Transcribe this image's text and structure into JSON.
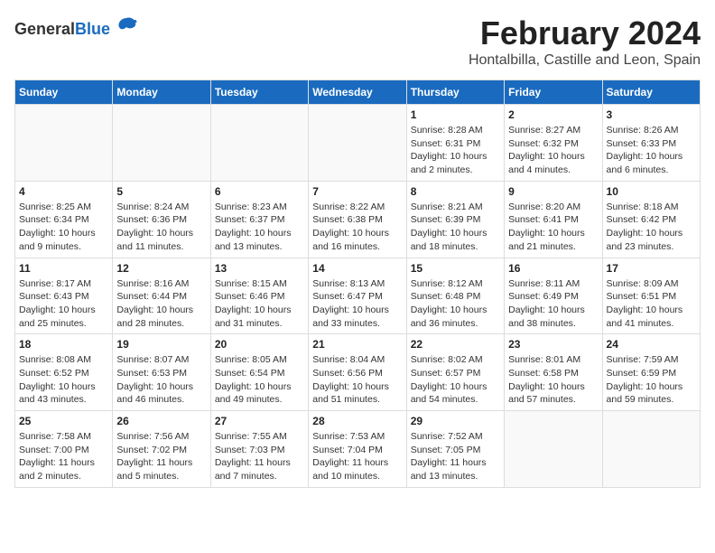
{
  "header": {
    "logo_general": "General",
    "logo_blue": "Blue",
    "month_year": "February 2024",
    "location": "Hontalbilla, Castille and Leon, Spain"
  },
  "weekdays": [
    "Sunday",
    "Monday",
    "Tuesday",
    "Wednesday",
    "Thursday",
    "Friday",
    "Saturday"
  ],
  "weeks": [
    [
      {
        "day": "",
        "info": ""
      },
      {
        "day": "",
        "info": ""
      },
      {
        "day": "",
        "info": ""
      },
      {
        "day": "",
        "info": ""
      },
      {
        "day": "1",
        "info": "Sunrise: 8:28 AM\nSunset: 6:31 PM\nDaylight: 10 hours and 2 minutes."
      },
      {
        "day": "2",
        "info": "Sunrise: 8:27 AM\nSunset: 6:32 PM\nDaylight: 10 hours and 4 minutes."
      },
      {
        "day": "3",
        "info": "Sunrise: 8:26 AM\nSunset: 6:33 PM\nDaylight: 10 hours and 6 minutes."
      }
    ],
    [
      {
        "day": "4",
        "info": "Sunrise: 8:25 AM\nSunset: 6:34 PM\nDaylight: 10 hours and 9 minutes."
      },
      {
        "day": "5",
        "info": "Sunrise: 8:24 AM\nSunset: 6:36 PM\nDaylight: 10 hours and 11 minutes."
      },
      {
        "day": "6",
        "info": "Sunrise: 8:23 AM\nSunset: 6:37 PM\nDaylight: 10 hours and 13 minutes."
      },
      {
        "day": "7",
        "info": "Sunrise: 8:22 AM\nSunset: 6:38 PM\nDaylight: 10 hours and 16 minutes."
      },
      {
        "day": "8",
        "info": "Sunrise: 8:21 AM\nSunset: 6:39 PM\nDaylight: 10 hours and 18 minutes."
      },
      {
        "day": "9",
        "info": "Sunrise: 8:20 AM\nSunset: 6:41 PM\nDaylight: 10 hours and 21 minutes."
      },
      {
        "day": "10",
        "info": "Sunrise: 8:18 AM\nSunset: 6:42 PM\nDaylight: 10 hours and 23 minutes."
      }
    ],
    [
      {
        "day": "11",
        "info": "Sunrise: 8:17 AM\nSunset: 6:43 PM\nDaylight: 10 hours and 25 minutes."
      },
      {
        "day": "12",
        "info": "Sunrise: 8:16 AM\nSunset: 6:44 PM\nDaylight: 10 hours and 28 minutes."
      },
      {
        "day": "13",
        "info": "Sunrise: 8:15 AM\nSunset: 6:46 PM\nDaylight: 10 hours and 31 minutes."
      },
      {
        "day": "14",
        "info": "Sunrise: 8:13 AM\nSunset: 6:47 PM\nDaylight: 10 hours and 33 minutes."
      },
      {
        "day": "15",
        "info": "Sunrise: 8:12 AM\nSunset: 6:48 PM\nDaylight: 10 hours and 36 minutes."
      },
      {
        "day": "16",
        "info": "Sunrise: 8:11 AM\nSunset: 6:49 PM\nDaylight: 10 hours and 38 minutes."
      },
      {
        "day": "17",
        "info": "Sunrise: 8:09 AM\nSunset: 6:51 PM\nDaylight: 10 hours and 41 minutes."
      }
    ],
    [
      {
        "day": "18",
        "info": "Sunrise: 8:08 AM\nSunset: 6:52 PM\nDaylight: 10 hours and 43 minutes."
      },
      {
        "day": "19",
        "info": "Sunrise: 8:07 AM\nSunset: 6:53 PM\nDaylight: 10 hours and 46 minutes."
      },
      {
        "day": "20",
        "info": "Sunrise: 8:05 AM\nSunset: 6:54 PM\nDaylight: 10 hours and 49 minutes."
      },
      {
        "day": "21",
        "info": "Sunrise: 8:04 AM\nSunset: 6:56 PM\nDaylight: 10 hours and 51 minutes."
      },
      {
        "day": "22",
        "info": "Sunrise: 8:02 AM\nSunset: 6:57 PM\nDaylight: 10 hours and 54 minutes."
      },
      {
        "day": "23",
        "info": "Sunrise: 8:01 AM\nSunset: 6:58 PM\nDaylight: 10 hours and 57 minutes."
      },
      {
        "day": "24",
        "info": "Sunrise: 7:59 AM\nSunset: 6:59 PM\nDaylight: 10 hours and 59 minutes."
      }
    ],
    [
      {
        "day": "25",
        "info": "Sunrise: 7:58 AM\nSunset: 7:00 PM\nDaylight: 11 hours and 2 minutes."
      },
      {
        "day": "26",
        "info": "Sunrise: 7:56 AM\nSunset: 7:02 PM\nDaylight: 11 hours and 5 minutes."
      },
      {
        "day": "27",
        "info": "Sunrise: 7:55 AM\nSunset: 7:03 PM\nDaylight: 11 hours and 7 minutes."
      },
      {
        "day": "28",
        "info": "Sunrise: 7:53 AM\nSunset: 7:04 PM\nDaylight: 11 hours and 10 minutes."
      },
      {
        "day": "29",
        "info": "Sunrise: 7:52 AM\nSunset: 7:05 PM\nDaylight: 11 hours and 13 minutes."
      },
      {
        "day": "",
        "info": ""
      },
      {
        "day": "",
        "info": ""
      }
    ]
  ]
}
